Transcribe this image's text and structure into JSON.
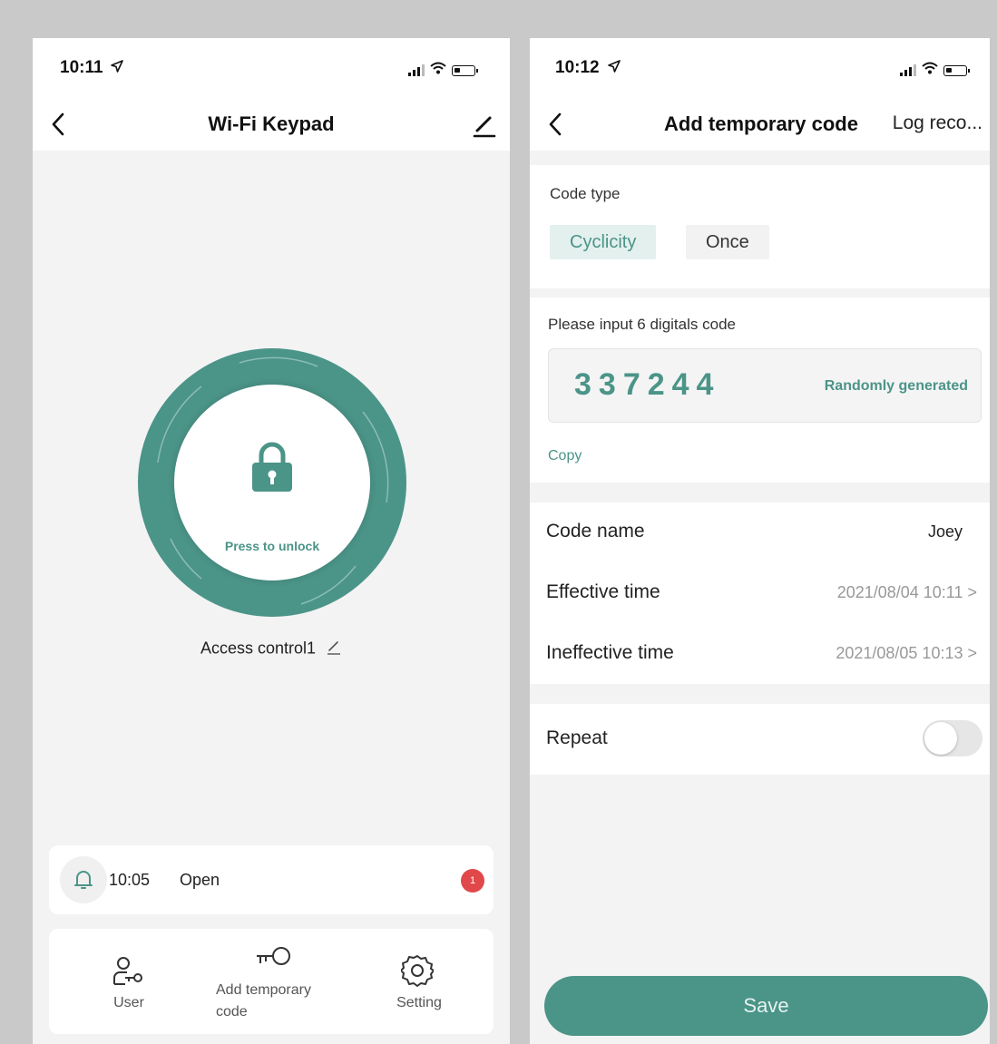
{
  "left_screen": {
    "status_time": "10:11",
    "title": "Wi-Fi Keypad",
    "unlock_label": "Press to unlock",
    "device_name": "Access control1",
    "log": {
      "time": "10:05",
      "status": "Open",
      "badge": "1"
    },
    "tabs": [
      {
        "label": "User",
        "icon": "user-key-icon"
      },
      {
        "label": "Add temporary code",
        "icon": "key-icon"
      },
      {
        "label": "Setting",
        "icon": "gear-icon"
      }
    ],
    "accent": "#4b9488"
  },
  "right_screen": {
    "status_time": "10:12",
    "title": "Add temporary code",
    "log_link": "Log reco...",
    "code_type_label": "Code type",
    "code_types": [
      "Cyclicity",
      "Once"
    ],
    "selected_code_type": "Cyclicity",
    "code_prompt": "Please input 6 digitals code",
    "code_value": "337244",
    "random_label": "Randomly generated",
    "copy_label": "Copy",
    "rows": [
      {
        "label": "Code name",
        "value": "Joey"
      },
      {
        "label": "Effective time",
        "value": "2021/08/04 10:11 >"
      },
      {
        "label": "Ineffective time",
        "value": "2021/08/05 10:13 >"
      }
    ],
    "repeat_label": "Repeat",
    "repeat_on": false,
    "save_label": "Save",
    "accent": "#4b9488"
  }
}
